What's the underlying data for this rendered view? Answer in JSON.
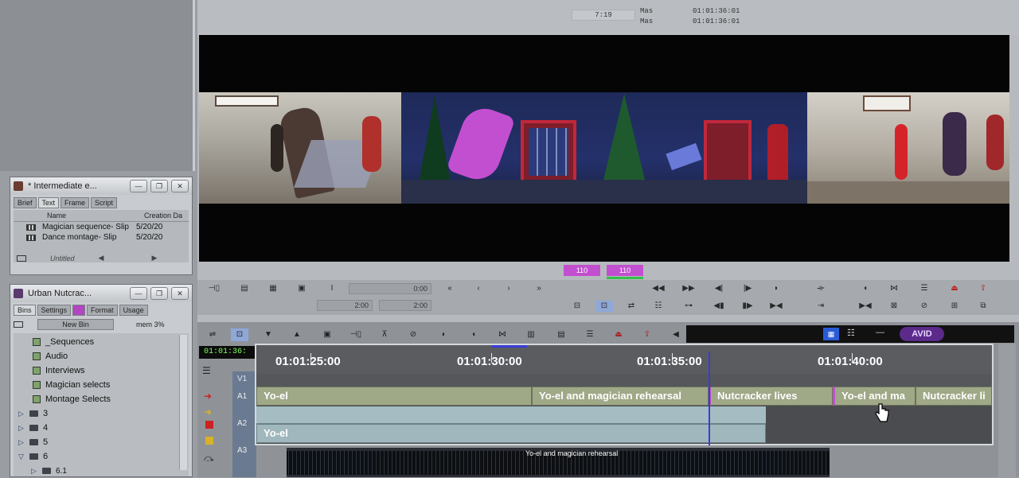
{
  "monitor": {
    "duration": "7:19",
    "mas_label_1": "Mas",
    "mas_label_2": "Mas",
    "timecode_1": "01:01:36:01",
    "timecode_2": "01:01:36:01",
    "field_top_value": "0:00",
    "field_bottom_value": "2:00",
    "field_bottom_value_2": "2:00",
    "meter_1": "110",
    "meter_2": "110"
  },
  "intermediate_bin": {
    "title": "* Intermediate e...",
    "tabs": [
      "Brief",
      "Text",
      "Frame",
      "Script"
    ],
    "active_tab": 1,
    "columns": [
      "Name",
      "Creation Da"
    ],
    "rows": [
      {
        "name": "Magician sequence- Slip",
        "date": "5/20/20"
      },
      {
        "name": "Dance montage- Slip",
        "date": "5/20/20"
      }
    ],
    "status": "Untitled"
  },
  "project": {
    "title": "Urban Nutcrac...",
    "tabs": [
      "Bins",
      "Settings",
      "Format",
      "Usage"
    ],
    "new_bin_label": "New Bin",
    "mem_label": "mem 3%",
    "bins": [
      "_Sequences",
      "Audio",
      "Interviews",
      "Magician selects",
      "Montage Selects"
    ],
    "folders": [
      "3",
      "4",
      "5",
      "6",
      "6.1"
    ]
  },
  "timeline": {
    "current_tc": "01:01:36:",
    "ruler": [
      "01:01:25:00",
      "01:01:30:00",
      "01:01:35:00",
      "01:01:40:00"
    ],
    "track_labels": [
      "V1",
      "A1",
      "A2",
      "A3"
    ],
    "v_clips": [
      "Yo-el",
      "Yo-el and magician rehearsal",
      "Nutcracker lives",
      "Yo-el and ma",
      "Nutcracker li"
    ],
    "a_clip": "Yo-el",
    "waveform_label": "Yo-el and magician rehearsal",
    "brand": "AVID"
  },
  "colors": {
    "accent_magenta": "#c24fcf",
    "playhead": "#3b3bd6",
    "timecode_green": "#7cff5a"
  }
}
